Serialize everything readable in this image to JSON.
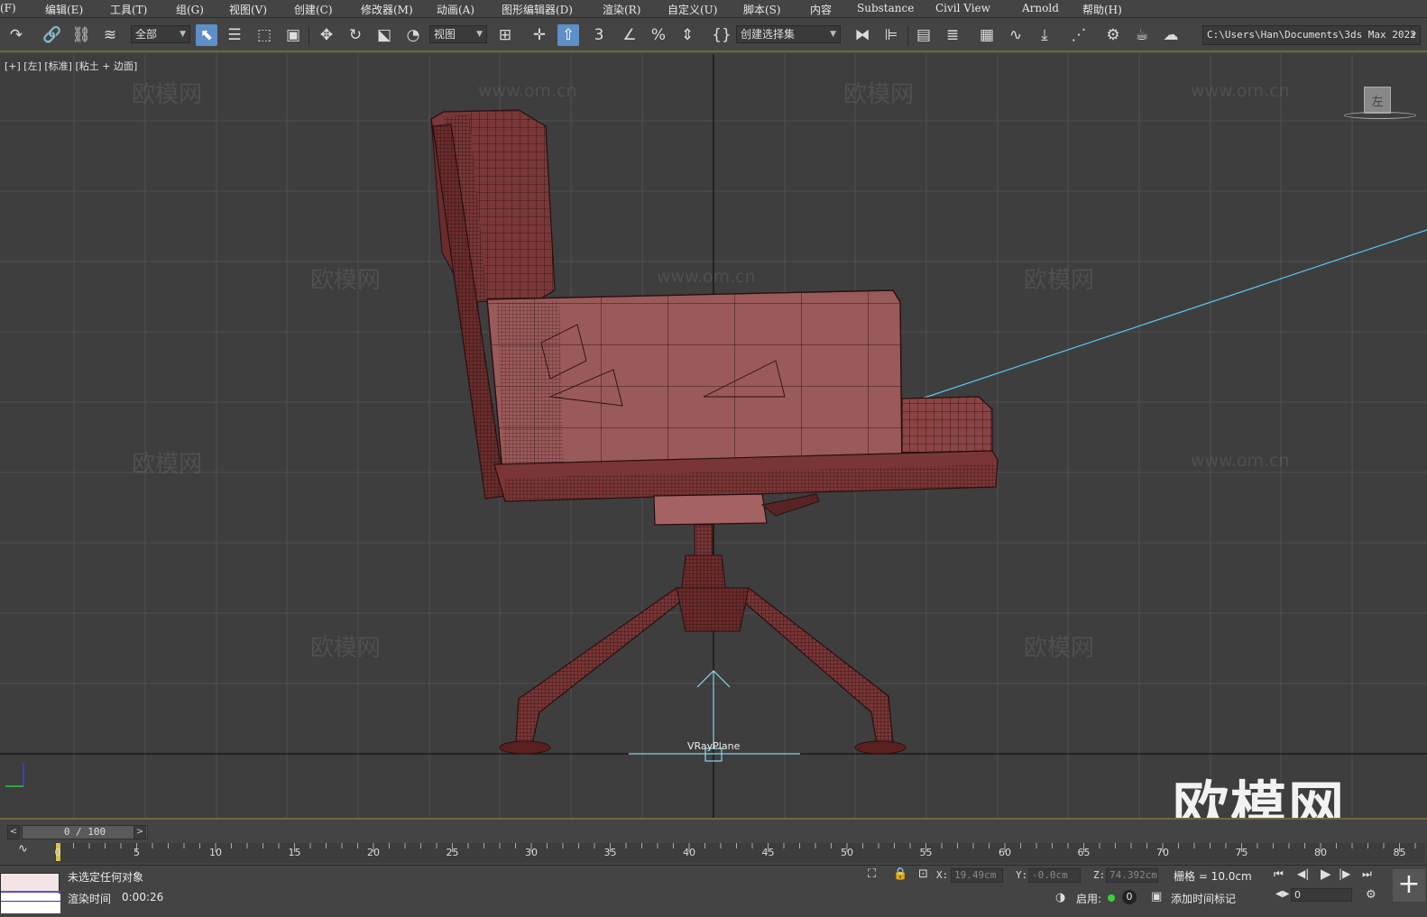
{
  "menu": {
    "items": [
      "(F)",
      "编辑(E)",
      "工具(T)",
      "组(G)",
      "视图(V)",
      "创建(C)",
      "修改器(M)",
      "动画(A)",
      "图形编辑器(D)",
      "渲染(R)",
      "自定义(U)",
      "脚本(S)",
      "内容",
      "Substance",
      "Civil View",
      "Arnold",
      "帮助(H)"
    ]
  },
  "toolbar": {
    "filter_dropdown": "全部",
    "coord_dropdown": "视图",
    "selection_set_dropdown": "创建选择集",
    "project_path": "C:\\Users\\Han\\Documents\\3ds Max 2022",
    "icons": [
      "undo-icon",
      "link-icon",
      "unlink-icon",
      "bind-space-warp-icon",
      "select-object-icon",
      "select-by-name-icon",
      "rect-region-icon",
      "window-crossing-icon",
      "move-icon",
      "rotate-icon",
      "scale-icon",
      "placement-icon",
      "pivot-icon",
      "snap-toggle-icon",
      "angle-snap-icon",
      "percent-snap-icon",
      "spinner-snap-icon",
      "edit-named-sets-icon",
      "mirror-icon",
      "align-icon",
      "scene-explorer-icon",
      "layer-explorer-icon",
      "ribbon-icon",
      "curve-editor-icon",
      "dope-sheet-icon",
      "schematic-icon",
      "material-editor-icon",
      "render-setup-icon",
      "render-frame-icon",
      "render-production-icon"
    ]
  },
  "viewport": {
    "label": "[+] [左] [标准] [粘土 + 边面]",
    "viewcube_label": "左",
    "object_label": "VRayPlane",
    "brand": "欧模网",
    "watermark_text": "欧模网",
    "watermark_url": "www.om.cn",
    "axis_labels": [
      "z",
      "y"
    ],
    "model_color": "#8e4a4a",
    "wire_color": "#2a0f0f",
    "grid_color": "#505050",
    "light_line_color": "#5ac8e8"
  },
  "timeline": {
    "frame_display": "0 / 100",
    "prev_label": "<",
    "next_label": ">",
    "ticks": [
      "0",
      "5",
      "10",
      "15",
      "20",
      "25",
      "30",
      "35",
      "40",
      "45",
      "50",
      "55",
      "60",
      "65",
      "70",
      "75",
      "80",
      "85"
    ]
  },
  "status": {
    "selection": "未选定任何对象",
    "render_time_label": "渲染时间",
    "render_time": "0:00:26",
    "x_label": "X:",
    "x_value": "19.49cm",
    "y_label": "Y:",
    "y_value": "-0.0cm",
    "z_label": "Z:",
    "z_value": "74.392cm",
    "grid": "栅格 = 10.0cm",
    "enable_label": "启用:",
    "enable_value": "0",
    "add_time_tag": "添加时间标记",
    "current_frame": "0"
  }
}
